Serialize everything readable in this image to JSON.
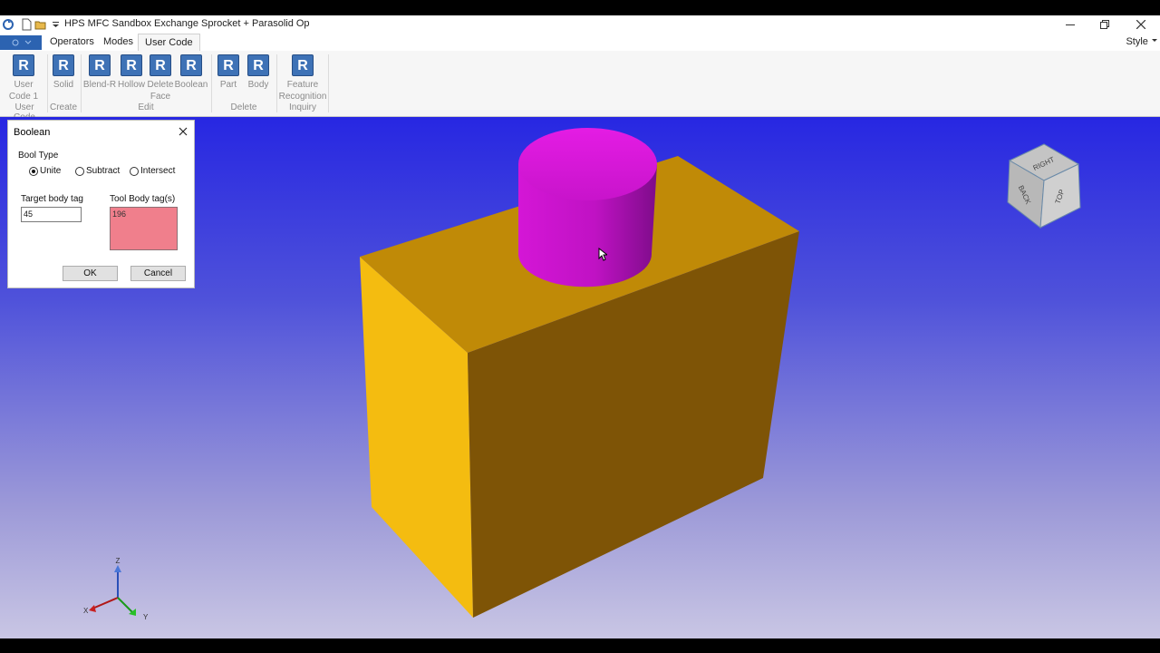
{
  "window": {
    "title": "HPS MFC Sandbox Exchange Sprocket + Parasolid Op"
  },
  "ribbon": {
    "tabs": [
      {
        "label": "Operators"
      },
      {
        "label": "Modes"
      },
      {
        "label": "User Code",
        "active": true
      }
    ],
    "style_label": "Style",
    "buttons": [
      {
        "icon": "R",
        "label": "User\nCode 1"
      },
      {
        "icon": "R",
        "label": "Solid"
      },
      {
        "icon": "R",
        "label": "Blend-R"
      },
      {
        "icon": "R",
        "label": "Hollow"
      },
      {
        "icon": "R",
        "label": "Delete\nFace"
      },
      {
        "icon": "R",
        "label": "Boolean"
      },
      {
        "icon": "R",
        "label": "Part"
      },
      {
        "icon": "R",
        "label": "Body"
      },
      {
        "icon": "R",
        "label": "Feature\nRecognition"
      }
    ],
    "groups": [
      "User Code",
      "Create",
      "Edit",
      "Delete",
      "Inquiry"
    ]
  },
  "dialog": {
    "title": "Boolean",
    "bool_type_label": "Bool Type",
    "options": [
      "Unite",
      "Subtract",
      "Intersect"
    ],
    "selected_option": "Unite",
    "target_label": "Target body tag",
    "target_value": "45",
    "tool_label": "Tool Body tag(s)",
    "tool_value": "196",
    "ok_label": "OK",
    "cancel_label": "Cancel"
  },
  "viewcube": {
    "faces": [
      "RIGHT",
      "BACK",
      "TOP"
    ]
  },
  "axis_triad": {
    "labels": [
      "Z",
      "X",
      "Y"
    ]
  },
  "colors": {
    "box_top": "#c08a07",
    "box_left": "#f4bc10",
    "box_front": "#7e5406",
    "cylinder": "#d815d9",
    "viewport_top": "#2727e2",
    "viewport_bottom": "#c9c6e4",
    "ribbon_icon": "#3e72b6"
  }
}
